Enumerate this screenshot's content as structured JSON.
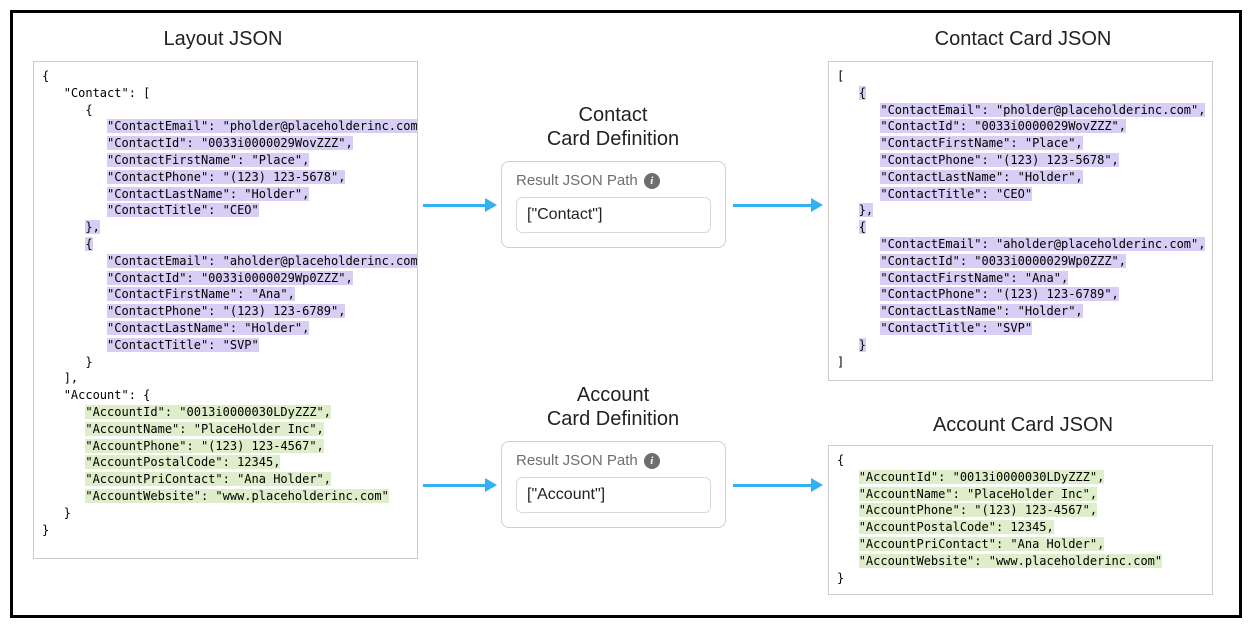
{
  "titles": {
    "layout": "Layout JSON",
    "contact_def": "Contact\nCard Definition",
    "account_def": "Account\nCard Definition",
    "contact_json": "Contact Card JSON",
    "account_json": "Account Card JSON"
  },
  "definition": {
    "label": "Result JSON Path",
    "contact_value": "[\"Contact\"]",
    "account_value": "[\"Account\"]"
  },
  "layout_code": [
    {
      "indent": 0,
      "hl": "",
      "text": "{"
    },
    {
      "indent": 1,
      "hl": "",
      "text": "\"Contact\": ["
    },
    {
      "indent": 2,
      "hl": "",
      "text": "{"
    },
    {
      "indent": 3,
      "hl": "p",
      "text": "\"ContactEmail\": \"pholder@placeholderinc.com\","
    },
    {
      "indent": 3,
      "hl": "p",
      "text": "\"ContactId\": \"0033i0000029WovZZZ\","
    },
    {
      "indent": 3,
      "hl": "p",
      "text": "\"ContactFirstName\": \"Place\","
    },
    {
      "indent": 3,
      "hl": "p",
      "text": "\"ContactPhone\": \"(123) 123-5678\","
    },
    {
      "indent": 3,
      "hl": "p",
      "text": "\"ContactLastName\": \"Holder\","
    },
    {
      "indent": 3,
      "hl": "p",
      "text": "\"ContactTitle\": \"CEO\""
    },
    {
      "indent": 2,
      "hl": "p",
      "text": "},"
    },
    {
      "indent": 2,
      "hl": "p",
      "text": "{"
    },
    {
      "indent": 3,
      "hl": "p",
      "text": "\"ContactEmail\": \"aholder@placeholderinc.com\","
    },
    {
      "indent": 3,
      "hl": "p",
      "text": "\"ContactId\": \"0033i0000029Wp0ZZZ\","
    },
    {
      "indent": 3,
      "hl": "p",
      "text": "\"ContactFirstName\": \"Ana\","
    },
    {
      "indent": 3,
      "hl": "p",
      "text": "\"ContactPhone\": \"(123) 123-6789\","
    },
    {
      "indent": 3,
      "hl": "p",
      "text": "\"ContactLastName\": \"Holder\","
    },
    {
      "indent": 3,
      "hl": "p",
      "text": "\"ContactTitle\": \"SVP\""
    },
    {
      "indent": 2,
      "hl": "",
      "text": "}"
    },
    {
      "indent": 1,
      "hl": "",
      "text": "],"
    },
    {
      "indent": 1,
      "hl": "",
      "text": "\"Account\": {"
    },
    {
      "indent": 2,
      "hl": "g",
      "text": "\"AccountId\": \"0013i0000030LDyZZZ\","
    },
    {
      "indent": 2,
      "hl": "g",
      "text": "\"AccountName\": \"PlaceHolder Inc\","
    },
    {
      "indent": 2,
      "hl": "g",
      "text": "\"AccountPhone\": \"(123) 123-4567\","
    },
    {
      "indent": 2,
      "hl": "g",
      "text": "\"AccountPostalCode\": 12345,"
    },
    {
      "indent": 2,
      "hl": "g",
      "text": "\"AccountPriContact\": \"Ana Holder\","
    },
    {
      "indent": 2,
      "hl": "g",
      "text": "\"AccountWebsite\": \"www.placeholderinc.com\""
    },
    {
      "indent": 1,
      "hl": "",
      "text": "}"
    },
    {
      "indent": 0,
      "hl": "",
      "text": "}"
    }
  ],
  "contact_card_code": [
    {
      "indent": 0,
      "hl": "",
      "text": "["
    },
    {
      "indent": 1,
      "hl": "p",
      "text": "{"
    },
    {
      "indent": 2,
      "hl": "p",
      "text": "\"ContactEmail\": \"pholder@placeholderinc.com\","
    },
    {
      "indent": 2,
      "hl": "p",
      "text": "\"ContactId\": \"0033i0000029WovZZZ\","
    },
    {
      "indent": 2,
      "hl": "p",
      "text": "\"ContactFirstName\": \"Place\","
    },
    {
      "indent": 2,
      "hl": "p",
      "text": "\"ContactPhone\": \"(123) 123-5678\","
    },
    {
      "indent": 2,
      "hl": "p",
      "text": "\"ContactLastName\": \"Holder\","
    },
    {
      "indent": 2,
      "hl": "p",
      "text": "\"ContactTitle\": \"CEO\""
    },
    {
      "indent": 1,
      "hl": "p",
      "text": "},"
    },
    {
      "indent": 1,
      "hl": "p",
      "text": "{"
    },
    {
      "indent": 2,
      "hl": "p",
      "text": "\"ContactEmail\": \"aholder@placeholderinc.com\","
    },
    {
      "indent": 2,
      "hl": "p",
      "text": "\"ContactId\": \"0033i0000029Wp0ZZZ\","
    },
    {
      "indent": 2,
      "hl": "p",
      "text": "\"ContactFirstName\": \"Ana\","
    },
    {
      "indent": 2,
      "hl": "p",
      "text": "\"ContactPhone\": \"(123) 123-6789\","
    },
    {
      "indent": 2,
      "hl": "p",
      "text": "\"ContactLastName\": \"Holder\","
    },
    {
      "indent": 2,
      "hl": "p",
      "text": "\"ContactTitle\": \"SVP\""
    },
    {
      "indent": 1,
      "hl": "p",
      "text": "}"
    },
    {
      "indent": 0,
      "hl": "",
      "text": "]"
    }
  ],
  "account_card_code": [
    {
      "indent": 0,
      "hl": "",
      "text": "{"
    },
    {
      "indent": 1,
      "hl": "g",
      "text": "\"AccountId\": \"0013i0000030LDyZZZ\","
    },
    {
      "indent": 1,
      "hl": "g",
      "text": "\"AccountName\": \"PlaceHolder Inc\","
    },
    {
      "indent": 1,
      "hl": "g",
      "text": "\"AccountPhone\": \"(123) 123-4567\","
    },
    {
      "indent": 1,
      "hl": "g",
      "text": "\"AccountPostalCode\": 12345,"
    },
    {
      "indent": 1,
      "hl": "g",
      "text": "\"AccountPriContact\": \"Ana Holder\","
    },
    {
      "indent": 1,
      "hl": "g",
      "text": "\"AccountWebsite\": \"www.placeholderinc.com\""
    },
    {
      "indent": 0,
      "hl": "",
      "text": "}"
    }
  ]
}
